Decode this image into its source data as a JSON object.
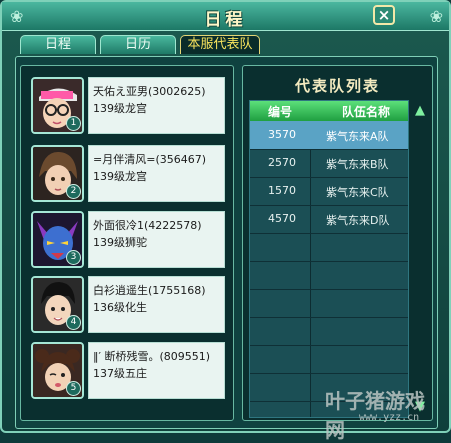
{
  "window": {
    "title": "日程",
    "close_label": "×"
  },
  "tabs": [
    {
      "label": "日程",
      "active": false
    },
    {
      "label": "日历",
      "active": false
    },
    {
      "label": "本服代表队",
      "active": true
    }
  ],
  "members": [
    {
      "name": "天佑え亚男",
      "id": "(3002625)",
      "level": "139级龙宫",
      "slot": "1",
      "icon": "girl-pink-cap-glasses"
    },
    {
      "name": "=月伴清风=",
      "id": "(356467)",
      "level": "139级龙宫",
      "slot": "2",
      "icon": "girl-brown-hair"
    },
    {
      "name": "外面很冷1",
      "id": "(4222578)",
      "level": "139级狮驼",
      "slot": "3",
      "icon": "demon-purple-blue"
    },
    {
      "name": "白衫逍遥生",
      "id": "(1755168)",
      "level": "136级化生",
      "slot": "4",
      "icon": "boy-black-hair"
    },
    {
      "name": "‖′ 断桥残雪。",
      "id": "(809551)",
      "level": "137级五庄",
      "slot": "5",
      "icon": "girl-twin-buns"
    }
  ],
  "team_list": {
    "title": "代表队列表",
    "col_id": "编号",
    "col_name": "队伍名称",
    "rows": [
      {
        "id": "3570",
        "name": "紫气东来A队",
        "selected": true
      },
      {
        "id": "2570",
        "name": "紫气东来B队",
        "selected": false
      },
      {
        "id": "1570",
        "name": "紫气东来C队",
        "selected": false
      },
      {
        "id": "4570",
        "name": "紫气东来D队",
        "selected": false
      }
    ],
    "empty_rows": 6
  },
  "watermark": {
    "main": "叶子猪游戏网",
    "url": "www.yzz.cn"
  }
}
